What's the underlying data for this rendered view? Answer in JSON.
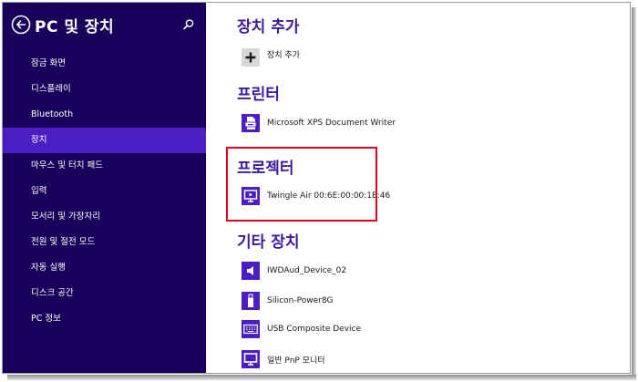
{
  "sidebar": {
    "title": "PC 및 장치",
    "items": [
      {
        "label": "잠금 화면",
        "selected": false
      },
      {
        "label": "디스플레이",
        "selected": false
      },
      {
        "label": "Bluetooth",
        "selected": false
      },
      {
        "label": "장치",
        "selected": true
      },
      {
        "label": "마우스 및 터치 패드",
        "selected": false
      },
      {
        "label": "입력",
        "selected": false
      },
      {
        "label": "모서리 및 가장자리",
        "selected": false
      },
      {
        "label": "전원 및 절전 모드",
        "selected": false
      },
      {
        "label": "자동 실행",
        "selected": false
      },
      {
        "label": "디스크 공간",
        "selected": false
      },
      {
        "label": "PC 정보",
        "selected": false
      }
    ]
  },
  "content": {
    "add_section": {
      "title": "장치 추가",
      "button_label": "장치 추가"
    },
    "printers": {
      "title": "프린터",
      "devices": [
        {
          "label": "Microsoft XPS Document Writer",
          "icon": "printer-icon"
        }
      ]
    },
    "projectors": {
      "title": "프로젝터",
      "devices": [
        {
          "label": "Twingle Air 00:6E:00:00:1E:46",
          "icon": "projector-icon"
        }
      ]
    },
    "other": {
      "title": "기타 장치",
      "devices": [
        {
          "label": "IWDAud_Device_02",
          "icon": "speaker-icon"
        },
        {
          "label": "Silicon-Power8G",
          "icon": "usb-drive-icon"
        },
        {
          "label": "USB Composite Device",
          "icon": "keyboard-icon"
        },
        {
          "label": "일반 PnP 모니터",
          "icon": "monitor-icon"
        }
      ]
    }
  },
  "colors": {
    "sidebar_bg": "#18005a",
    "selected_bg": "#4a1ec2",
    "accent": "#3d1a9e",
    "highlight_border": "#e0001b"
  }
}
